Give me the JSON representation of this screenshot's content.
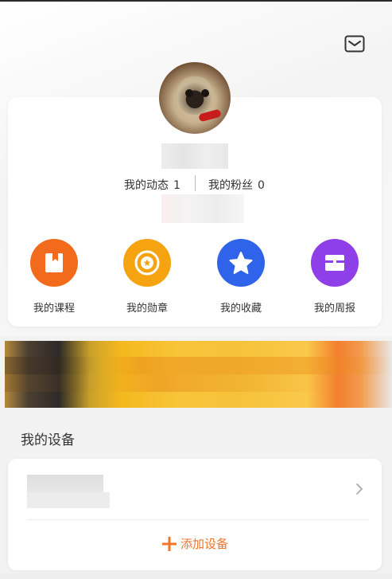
{
  "header": {
    "mail_icon": "mail-icon"
  },
  "profile": {
    "avatar_icon": "pug-avatar",
    "stats": [
      {
        "label": "我的动态",
        "value": "1"
      },
      {
        "label": "我的粉丝",
        "value": "0"
      }
    ]
  },
  "menu": [
    {
      "label": "我的课程",
      "icon": "book-icon",
      "color": "#f26a1b"
    },
    {
      "label": "我的勋章",
      "icon": "medal-icon",
      "color": "#f5a311"
    },
    {
      "label": "我的收藏",
      "icon": "star-icon",
      "color": "#2f63ea"
    },
    {
      "label": "我的周报",
      "icon": "report-icon",
      "color": "#8f3fe7"
    }
  ],
  "devices": {
    "title": "我的设备",
    "add_label": "添加设备",
    "accent": "#f0752a"
  }
}
